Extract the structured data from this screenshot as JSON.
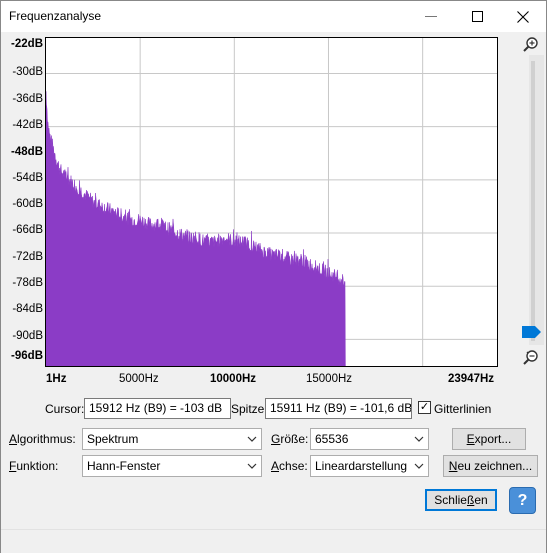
{
  "window": {
    "title": "Frequenzanalyse",
    "minimize_glyph": "—",
    "maximize_glyph": "☐",
    "close_glyph": "✕"
  },
  "plot": {
    "y_ticks": [
      "-22dB",
      "-30dB",
      "-36dB",
      "-42dB",
      "-48dB",
      "-54dB",
      "-60dB",
      "-66dB",
      "-72dB",
      "-78dB",
      "-84dB",
      "-90dB",
      "-96dB"
    ],
    "x_ticks": [
      {
        "label": "1Hz",
        "bold": true
      },
      {
        "label": "5000Hz",
        "bold": false
      },
      {
        "label": "10000Hz",
        "bold": true
      },
      {
        "label": "15000Hz",
        "bold": false
      },
      {
        "label": "23947Hz",
        "bold": true
      }
    ],
    "grid": true,
    "fill_color": "#8b3cc6"
  },
  "chart_data": {
    "type": "area",
    "xlabel": "",
    "ylabel": "",
    "xlim": [
      1,
      23947
    ],
    "ylim": [
      -96,
      -22
    ],
    "x_gridlines": [
      5000,
      10000,
      15000,
      20000
    ],
    "y_gridlines": [
      -30,
      -42,
      -54,
      -66,
      -78,
      -90
    ],
    "x": [
      1,
      100,
      200,
      400,
      600,
      800,
      1000,
      1500,
      2000,
      2500,
      3000,
      3500,
      4000,
      4500,
      5000,
      5500,
      6000,
      6500,
      7000,
      7500,
      8000,
      8500,
      9000,
      9500,
      10000,
      10500,
      11000,
      11500,
      12000,
      12500,
      13000,
      13500,
      14000,
      14500,
      15000,
      15500,
      15900,
      15912
    ],
    "y": [
      -34,
      -41,
      -44,
      -47,
      -50,
      -52,
      -53,
      -55,
      -57,
      -59,
      -60,
      -61,
      -62,
      -63,
      -63,
      -64,
      -64,
      -65,
      -66,
      -67,
      -67,
      -68,
      -68,
      -67,
      -68,
      -68,
      -69,
      -70,
      -71,
      -71,
      -72,
      -72,
      -73,
      -74,
      -75,
      -76,
      -77,
      -96
    ]
  },
  "cursor": {
    "label": "Cursor:",
    "value": "15912 Hz (B9) = -103 dB"
  },
  "peak": {
    "label": "Spitze:",
    "value": "15911 Hz (B9) = -101,6 dB"
  },
  "gridlines_checkbox": {
    "label": "Gitterlinien",
    "checked": true,
    "check_glyph": "✓"
  },
  "algorithm": {
    "label_underline": "A",
    "label_rest": "lgorithmus:",
    "value": "Spektrum"
  },
  "size": {
    "label_underline": "G",
    "label_rest": "röße:",
    "value": "65536"
  },
  "function": {
    "label_underline": "F",
    "label_rest": "unktion:",
    "value": "Hann-Fenster"
  },
  "axis": {
    "label_underline": "A",
    "label_rest": "chse:",
    "value": "Lineardarstellung"
  },
  "buttons": {
    "export_underline": "E",
    "export_rest": "xport...",
    "redraw_underline": "N",
    "redraw_rest": "eu zeichnen...",
    "close_pre": "Schlie",
    "close_underline": "ß",
    "close_post": "en",
    "help": "?"
  },
  "dropdown_arrow": "⌵",
  "scroll_down_arrow": "⌄"
}
